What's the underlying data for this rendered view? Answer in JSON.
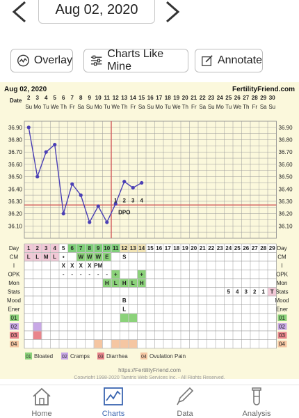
{
  "header": {
    "date": "Aug 02, 2020"
  },
  "toolbar": {
    "overlay": "Overlay",
    "charts_like_mine": "Charts Like Mine",
    "annotate": "Annotate"
  },
  "chart_header": {
    "date": "Aug 02, 2020",
    "site": "FertilityFriend.com"
  },
  "footer": {
    "url": "https://FertilityFriend.com",
    "copyright": "Copyright 1998-2020 Tamtris Web Services Inc. - All Rights Reserved."
  },
  "nav": {
    "home": "Home",
    "charts": "Charts",
    "data": "Data",
    "analysis": "Analysis"
  },
  "colors": {
    "accent": "#3a65b0",
    "chart_bg": "#fbf8dc",
    "temp_line": "#4a3fb5",
    "coverline": "#d35b5b",
    "fertile_green": "#8bd27a",
    "period_pink": "#f2c9d7"
  },
  "chart_data": {
    "type": "line",
    "row_labels": {
      "date": "Date",
      "day": "Day",
      "cm": "CM",
      "i": "I",
      "opk": "OPK",
      "mon": "Mon",
      "stats": "Stats",
      "mood": "Mood",
      "ener": "Ener"
    },
    "dates": [
      "2",
      "3",
      "4",
      "5",
      "6",
      "7",
      "8",
      "9",
      "10",
      "11",
      "12",
      "13",
      "14",
      "15",
      "16",
      "17",
      "18",
      "19",
      "20",
      "21",
      "22",
      "23",
      "24",
      "25",
      "26",
      "27",
      "28",
      "29",
      "30"
    ],
    "weekdays": [
      "Su",
      "Mo",
      "Tu",
      "We",
      "Th",
      "Fr",
      "Sa",
      "Su",
      "Mo",
      "Tu",
      "We",
      "Th",
      "Fr",
      "Sa",
      "Su",
      "Mo",
      "Tu",
      "We",
      "Th",
      "Fr",
      "Sa",
      "Su",
      "Mo",
      "Tu",
      "We",
      "Th",
      "Fr",
      "Sa",
      "Su"
    ],
    "days": [
      "1",
      "2",
      "3",
      "4",
      "5",
      "6",
      "7",
      "8",
      "9",
      "10",
      "11",
      "12",
      "13",
      "14",
      "15",
      "16",
      "17",
      "18",
      "19",
      "20",
      "21",
      "22",
      "23",
      "24",
      "25",
      "26",
      "27",
      "28",
      "29"
    ],
    "temps": [
      36.9,
      36.5,
      36.7,
      36.76,
      36.2,
      36.44,
      36.35,
      36.13,
      36.26,
      36.13,
      36.28,
      36.46,
      36.41,
      36.45
    ],
    "temp_ticks": [
      "36.90",
      "36.80",
      "36.70",
      "36.60",
      "36.50",
      "36.40",
      "36.30",
      "36.20",
      "36.10"
    ],
    "ylim": [
      36.0,
      36.95
    ],
    "coverline": 36.27,
    "ovulation_day_index": 9,
    "dpo": [
      "1",
      "2",
      "3",
      "4"
    ],
    "dpo_label": "DPO",
    "cm": [
      "L",
      "L",
      "M",
      "L",
      "•",
      "",
      "W",
      "W",
      "W",
      "E",
      "",
      "S"
    ],
    "intercourse": [
      "",
      "",
      "",
      "",
      "X",
      "X",
      "X",
      "X",
      "PM",
      "",
      "",
      "",
      ""
    ],
    "opk": [
      "",
      "",
      "",
      "",
      "-",
      "-",
      "-",
      "-",
      "-",
      "-",
      "+",
      "",
      "",
      "+"
    ],
    "mon": [
      "",
      "",
      "",
      "",
      "",
      "",
      "",
      "",
      "",
      "H",
      "L",
      "H",
      "L",
      "H"
    ],
    "stats": [
      "",
      "",
      "",
      "",
      "",
      "",
      "",
      "",
      "",
      "",
      "",
      "",
      "",
      "",
      "",
      "",
      "",
      "",
      "",
      "",
      "",
      "",
      "",
      "5",
      "4",
      "3",
      "2",
      "1",
      "T"
    ],
    "mood": [
      "",
      "",
      "",
      "",
      "",
      "",
      "",
      "",
      "",
      "",
      "",
      "B"
    ],
    "ener": [
      "",
      "",
      "",
      "",
      "",
      "",
      "",
      "",
      "",
      "",
      "",
      "L"
    ],
    "legend": [
      {
        "code": "01",
        "label": "Bloated"
      },
      {
        "code": "02",
        "label": "Cramps"
      },
      {
        "code": "03",
        "label": "Diarrhea"
      },
      {
        "code": "04",
        "label": "Ovulation Pain"
      }
    ]
  }
}
